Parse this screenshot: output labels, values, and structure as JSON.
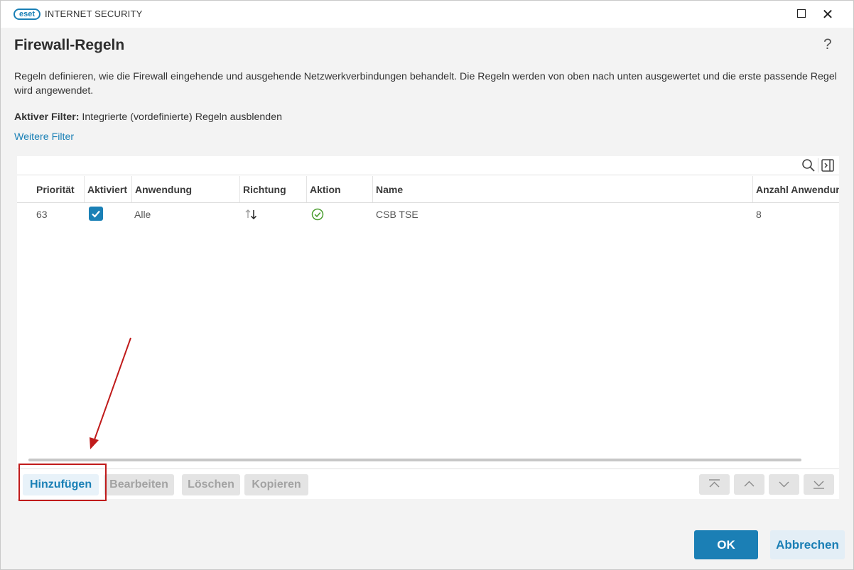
{
  "window": {
    "logo_text": "eset",
    "product_name": "INTERNET SECURITY",
    "maximize_icon": "maximize-icon",
    "close_icon": "close-icon"
  },
  "header": {
    "title": "Firewall-Regeln",
    "help_label": "?",
    "description": "Regeln definieren, wie die Firewall eingehende und ausgehende Netzwerkverbindungen behandelt. Die Regeln werden von oben nach unten ausgewertet und die erste passende Regel wird angewendet.",
    "filter_label": "Aktiver Filter:",
    "filter_value": "Integrierte (vordefinierte) Regeln ausblenden",
    "more_filters": "Weitere Filter"
  },
  "table": {
    "toolbar_icons": [
      "search-icon",
      "column-settings-icon"
    ],
    "columns": [
      "Priorität",
      "Aktiviert",
      "Anwendung",
      "Richtung",
      "Aktion",
      "Name",
      "Anzahl Anwendungen"
    ],
    "rows": [
      {
        "priority": "63",
        "enabled": true,
        "application": "Alle",
        "direction": "both",
        "action": "allow",
        "name": "CSB TSE",
        "count": "8"
      }
    ]
  },
  "buttons": {
    "add": "Hinzufügen",
    "edit": "Bearbeiten",
    "delete": "Löschen",
    "copy": "Kopieren",
    "move_icons": [
      "move-top-icon",
      "move-up-icon",
      "move-down-icon",
      "move-bottom-icon"
    ],
    "ok": "OK",
    "cancel": "Abbrechen"
  },
  "colors": {
    "accent": "#1a80b6",
    "annotation": "#c01b1b",
    "action_allow": "#4a9d2f"
  }
}
